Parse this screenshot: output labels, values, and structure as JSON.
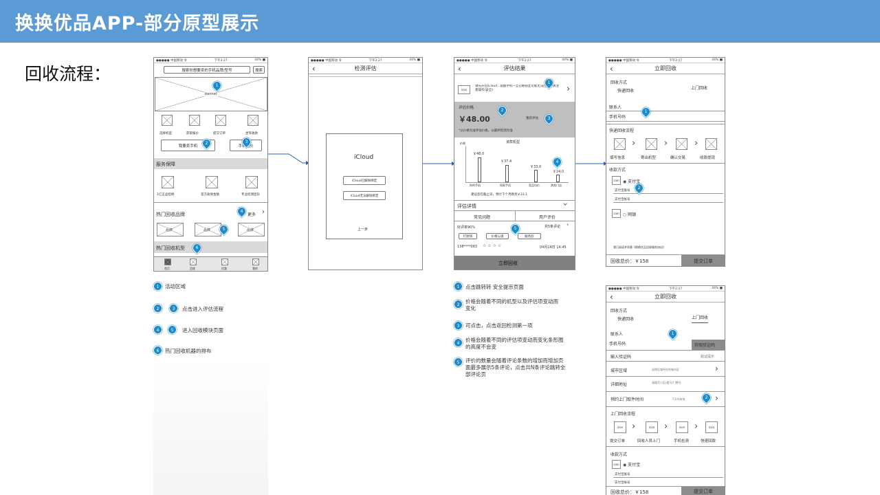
{
  "header": {
    "title": "换换优品APP-部分原型展示"
  },
  "section": {
    "title": "回收流程："
  },
  "status": {
    "carrier": "●●●●● 中国移动 令",
    "time": "下午2:27",
    "battery": "44% ■"
  },
  "s1": {
    "search_placeholder": "搜索你想要卖的手机品牌/型号",
    "search_btn": "搜索",
    "banner": "banner",
    "cats": [
      "选择机型",
      "获取报价",
      "提交订单",
      "坐等收款"
    ],
    "sell_btn": "我要卖手机",
    "estimate_btn": "手机估价",
    "service_title": "服务保障",
    "services": [
      "1亿正品担保",
      "官方质保金额",
      "专业检测团队"
    ],
    "brand_title": "热门回收品牌",
    "more": "更多",
    "brand": "品牌",
    "model_title": "热门回收机型",
    "tabs": [
      "首页",
      "回收",
      "优惠",
      "我的"
    ]
  },
  "s2": {
    "title": "检测评估",
    "icloud": "iCloud",
    "btn1": "iCloud已解除绑定",
    "btn2": "iCloud无法解除绑定",
    "prev": "上一步"
  },
  "s3": {
    "title": "评估结果",
    "tip": "请先开启iCloud...提醒手机一旦已被锁定可能无法回收，请注意操作(安全)",
    "price_label": "评估价格",
    "price": "￥48.00",
    "reeval": "重新评估",
    "price_note": "*以价格为准评估价格，以最终检测为准",
    "chart_title": "该款机型",
    "bars": [
      {
        "l": "￥48.0",
        "c": "你的手机"
      },
      {
        "l": "￥37.4",
        "c": "同款手机"
      },
      {
        "l": "￥33.0",
        "c": "竞品均价"
      },
      {
        "l": "￥24.0",
        "c": "其他门店"
      }
    ],
    "trend": "建议您在截止日，预计下个月跌到￥23.1",
    "detail": "评估详情",
    "faq": "常见问题",
    "user_eval": "用户评价",
    "rate": "好评率90%",
    "more_eval": "共5条评论",
    "tags": [
      "打款快",
      "价格公道",
      "服务好"
    ],
    "user": "138****083",
    "stars": "☆ ☆ ☆ ☆",
    "date": "04月14日 14:45",
    "cta": "立即回收"
  },
  "s4": {
    "title": "立即回收",
    "method_label": "回收方式",
    "m1": "快递回收",
    "m2": "上门回收",
    "contact": "联系人",
    "phone": "手机号码",
    "flow_title": "快递回收流程",
    "flow": [
      "填写信息",
      "寄出机型",
      "确认交易",
      "收款提现"
    ],
    "pay_title": "收款方式",
    "alipay": "支付宝",
    "acc_name": "支付宝账号",
    "acc_no": "支付宝帐号",
    "bank": "网银",
    "agree": "我已阅读并同意《换换优品回收服务协议》",
    "total": "回收总价：￥158",
    "submit": "提交订单"
  },
  "s5": {
    "title": "立即回收",
    "method_label": "回收方式",
    "m1": "快递回收",
    "m2": "上门回收",
    "contact": "联系人",
    "phone": "手机号码",
    "get_code": "获取验证码",
    "code_label": "输入验证码",
    "code_ph": "验证提示",
    "city": "城市区域",
    "city_ph": "选择区域所在的城市区",
    "addr": "详细地址",
    "addr_ph": "请填写小区/楼号/门牌号",
    "time": "预约上门取件时间",
    "time_ph": "7天内有效",
    "flow_title": "上门回收流程",
    "flow": [
      "提交订单",
      "回收人员上门",
      "手机检测",
      "快速回款"
    ],
    "pay_title": "收款方式",
    "alipay": "支付宝",
    "acc_name": "支付宝账号",
    "acc_no": "支付宝帐号",
    "total": "回收总价：￥158",
    "submit": "提交订单"
  },
  "icon_word": "icon",
  "notes1": [
    "活动区域",
    "点击进入评估流程",
    "进入回收模块页面",
    "热门回收机器的排布"
  ],
  "notes3": [
    "点击跳转转 安全提示页面",
    "价格会随着不同的机型以及评估项变动而变化",
    "可点击，点击返回检测第一项",
    "价格会随着不同的评估项变动而变化条形图的高度不会变",
    "评价的数量会随着评论条数的增加而增加页面最多展示5条评论，点击共N条评论跳转全部评论页"
  ]
}
